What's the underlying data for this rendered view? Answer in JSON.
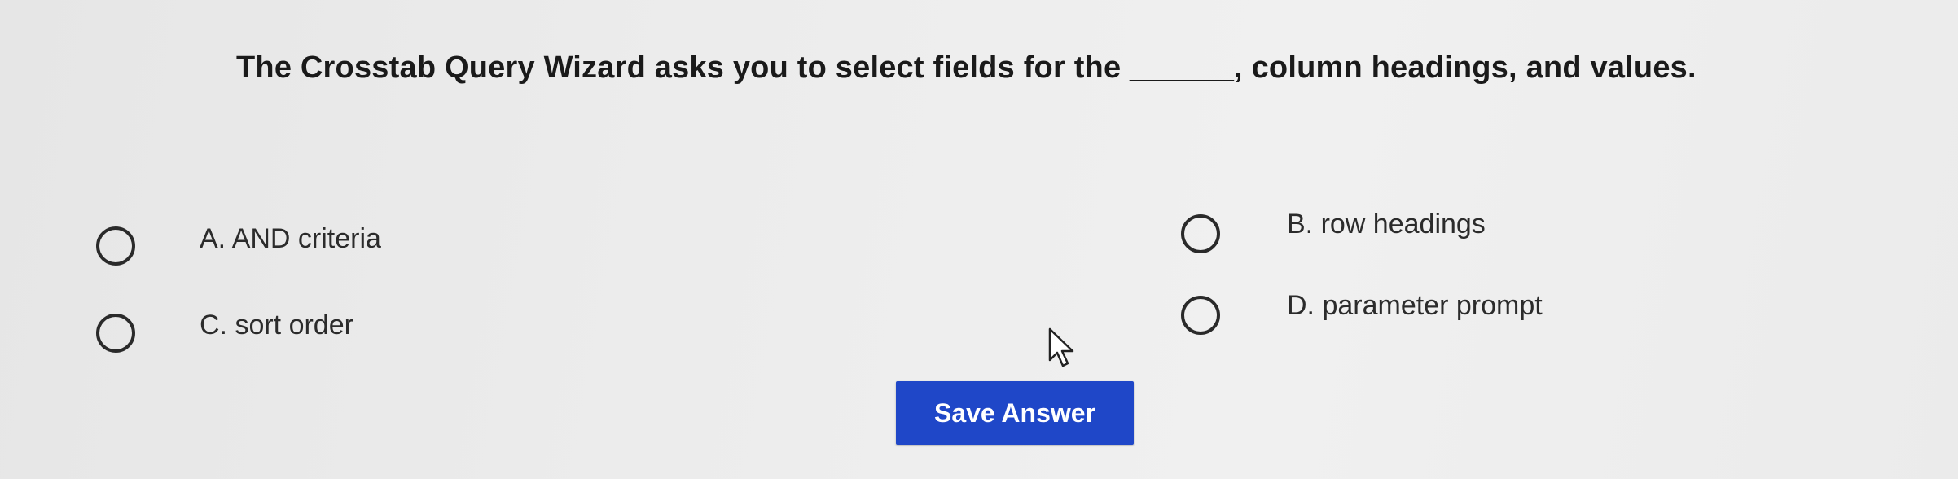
{
  "question": {
    "text": "The Crosstab Query Wizard asks you to select fields for the ______, column headings, and values."
  },
  "options": [
    {
      "id": "a",
      "label": "A. AND criteria"
    },
    {
      "id": "b",
      "label": "B. row headings"
    },
    {
      "id": "c",
      "label": "C. sort order"
    },
    {
      "id": "d",
      "label": "D. parameter prompt"
    }
  ],
  "actions": {
    "save_label": "Save Answer"
  },
  "colors": {
    "button_bg": "#1f47c8",
    "button_text": "#ffffff",
    "radio_border": "#2a2a2a"
  },
  "icons": {
    "cursor": "mouse-pointer-icon"
  }
}
